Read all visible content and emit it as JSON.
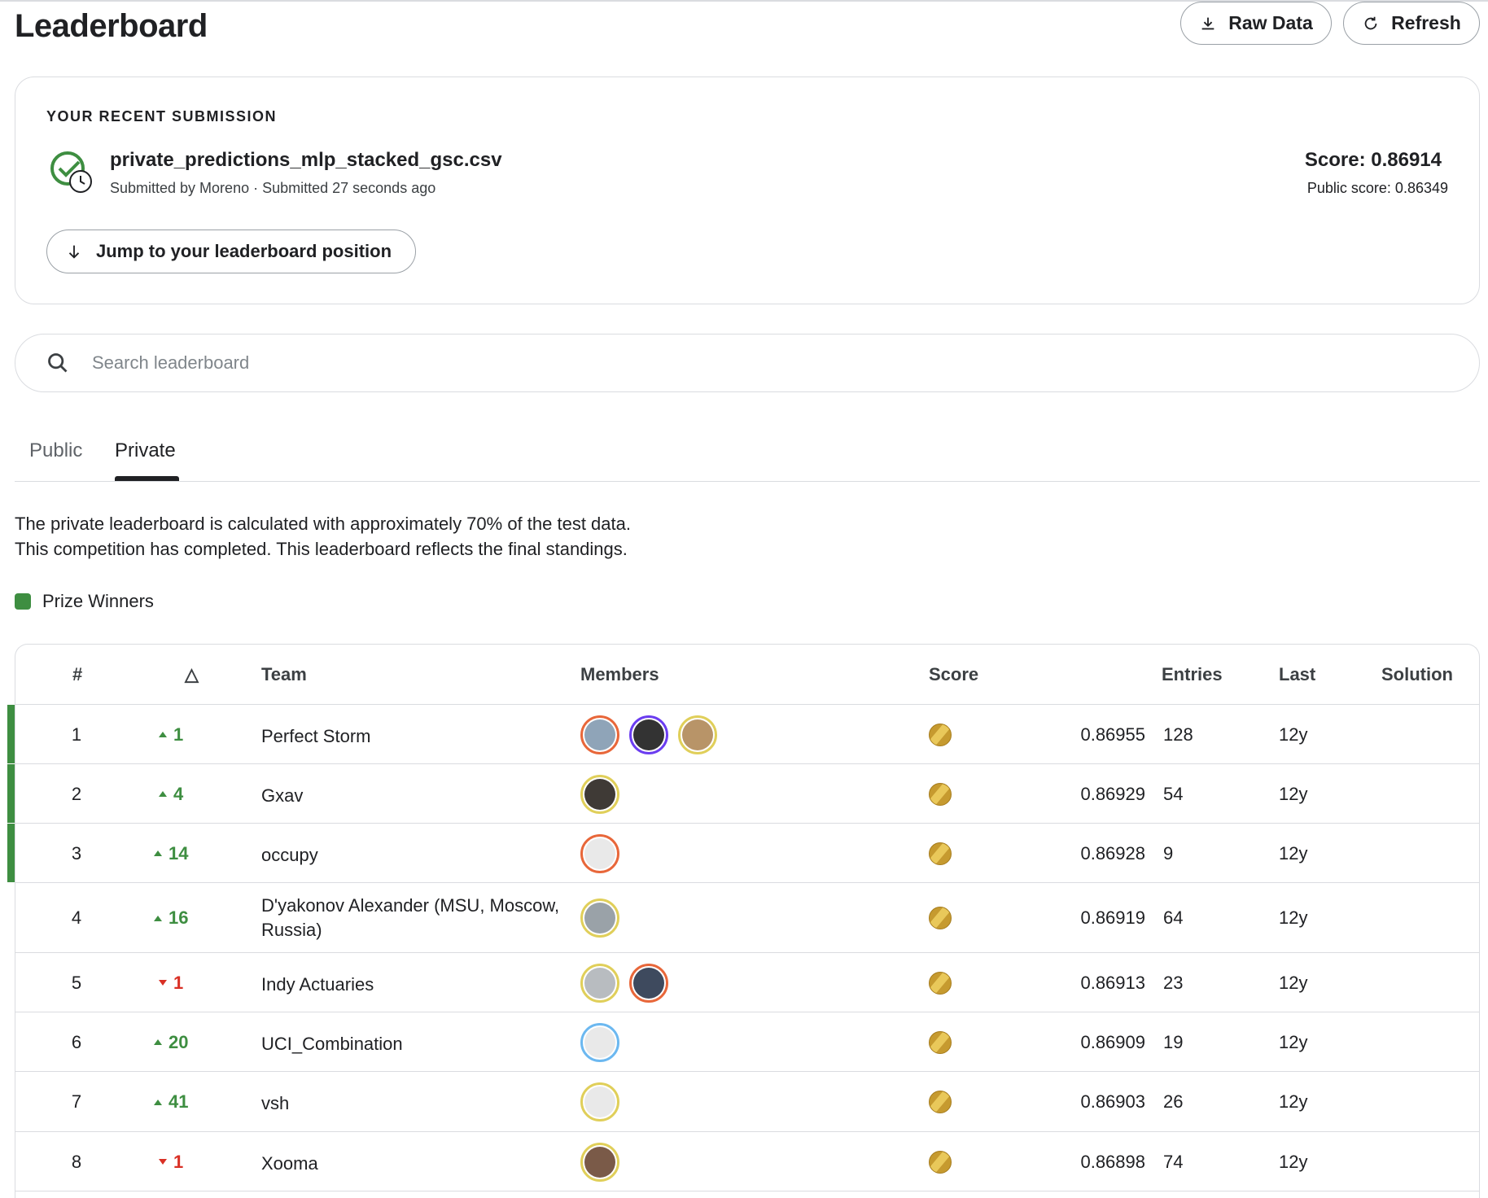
{
  "page": {
    "title": "Leaderboard"
  },
  "header_buttons": {
    "raw_data": "Raw Data",
    "refresh": "Refresh"
  },
  "submission": {
    "heading": "YOUR RECENT SUBMISSION",
    "file": "private_predictions_mlp_stacked_gsc.csv",
    "meta": "Submitted by Moreno · Submitted 27 seconds ago",
    "score": "Score: 0.86914",
    "public_score": "Public score: 0.86349",
    "jump_label": "Jump to your leaderboard position"
  },
  "search": {
    "placeholder": "Search leaderboard"
  },
  "tabs": [
    {
      "label": "Public"
    },
    {
      "label": "Private",
      "active": true
    }
  ],
  "description": {
    "line1": "The private leaderboard is calculated with approximately 70% of the test data.",
    "line2": "This competition has completed. This leaderboard reflects the final standings."
  },
  "legend": {
    "prize_winners": "Prize Winners",
    "color": "#3e8e41"
  },
  "table": {
    "headers": {
      "rank": "#",
      "delta": "△",
      "team": "Team",
      "members": "Members",
      "score": "Score",
      "entries": "Entries",
      "last": "Last",
      "solution": "Solution"
    },
    "rows": [
      {
        "rank": "1",
        "direction": "up",
        "delta": "1",
        "team": "Perfect Storm",
        "score": "0.86955",
        "entries": "128",
        "last": "12y",
        "prize": true
      },
      {
        "rank": "2",
        "direction": "up",
        "delta": "4",
        "team": "Gxav",
        "score": "0.86929",
        "entries": "54",
        "last": "12y",
        "prize": true
      },
      {
        "rank": "3",
        "direction": "up",
        "delta": "14",
        "team": "occupy",
        "score": "0.86928",
        "entries": "9",
        "last": "12y",
        "prize": true
      },
      {
        "rank": "4",
        "direction": "up",
        "delta": "16",
        "team": "D'yakonov Alexander (MSU, Moscow, Russia)",
        "score": "0.86919",
        "entries": "64",
        "last": "12y",
        "prize": false
      },
      {
        "rank": "5",
        "direction": "down",
        "delta": "1",
        "team": "Indy Actuaries",
        "score": "0.86913",
        "entries": "23",
        "last": "12y",
        "prize": false
      },
      {
        "rank": "6",
        "direction": "up",
        "delta": "20",
        "team": "UCI_Combination",
        "score": "0.86909",
        "entries": "19",
        "last": "12y",
        "prize": false
      },
      {
        "rank": "7",
        "direction": "up",
        "delta": "41",
        "team": "vsh",
        "score": "0.86903",
        "entries": "26",
        "last": "12y",
        "prize": false
      },
      {
        "rank": "8",
        "direction": "down",
        "delta": "1",
        "team": "Xooma",
        "score": "0.86898",
        "entries": "74",
        "last": "12y",
        "prize": false
      }
    ]
  },
  "colors": {
    "up": "#3e8e41",
    "down": "#d93025",
    "medal_gold": "#c69a2f"
  }
}
